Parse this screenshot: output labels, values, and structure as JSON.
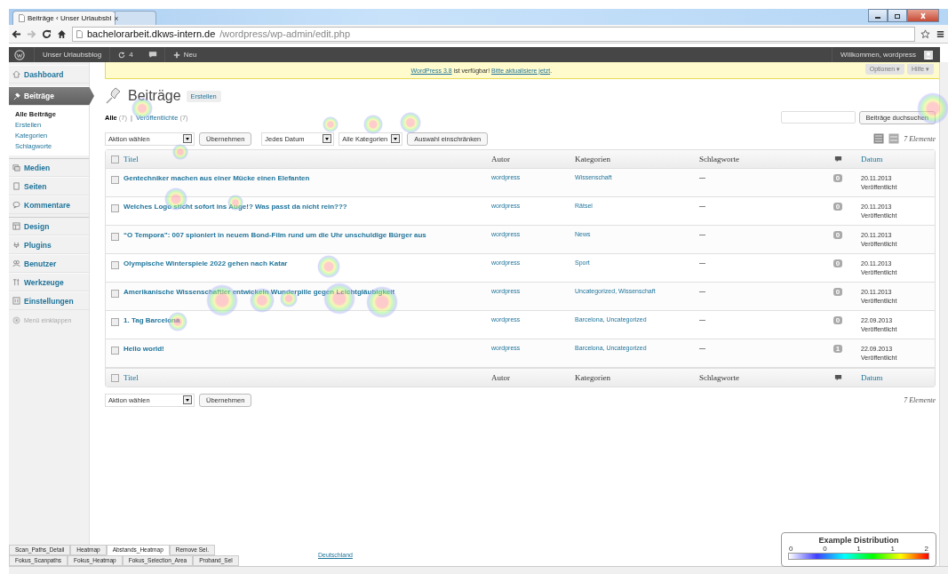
{
  "browser": {
    "tabs": [
      {
        "title": "Beiträge ‹ Unser Urlaubsbl",
        "close": "×",
        "selected": true
      },
      {
        "selected": false
      }
    ],
    "url": {
      "host": "bachelorarbeit.dkws-intern.de",
      "path": "/wordpress/wp-admin/edit.php"
    }
  },
  "admin_bar": {
    "site": "Unser Urlaubsblog",
    "updates": "4",
    "new": "Neu",
    "greeting": "Willkommen, wordpress"
  },
  "sidebar": {
    "items": [
      {
        "label": "Dashboard",
        "selected": false
      },
      {
        "label": "Beiträge",
        "selected": true,
        "children": [
          {
            "label": "Alle Beiträge",
            "selected": true
          },
          {
            "label": "Erstellen",
            "selected": false
          },
          {
            "label": "Kategorien",
            "selected": false
          },
          {
            "label": "Schlagworte",
            "selected": false
          }
        ]
      },
      {
        "label": "Medien",
        "selected": false
      },
      {
        "label": "Seiten",
        "selected": false
      },
      {
        "label": "Kommentare",
        "selected": false
      },
      {
        "label": "Design",
        "selected": false
      },
      {
        "label": "Plugins",
        "selected": false
      },
      {
        "label": "Benutzer",
        "selected": false
      },
      {
        "label": "Werkzeuge",
        "selected": false
      },
      {
        "label": "Einstellungen",
        "selected": false
      }
    ],
    "collapse": "Menü einklappen"
  },
  "notice": {
    "link": "WordPress 3.8",
    "text": " ist verfügbar! ",
    "action": "Bitte aktualisiere jetzt",
    "end": "."
  },
  "screen_buttons": [
    "Optionen ▾",
    "Hilfe ▾"
  ],
  "page": {
    "title": "Beiträge",
    "add_button": "Erstellen"
  },
  "filters": [
    {
      "label": "Alle",
      "count": "(7)",
      "selected": true
    },
    {
      "label": "Veröffentlichte",
      "count": "(7)",
      "selected": false
    }
  ],
  "filter_separator": "|",
  "search": {
    "button": "Beiträge duchsuchen"
  },
  "bulk": {
    "action": "Aktion wählen",
    "apply": "Übernehmen",
    "date": "Jedes Datum",
    "category": "Alle Kategorien",
    "filter": "Auswahl einschränken"
  },
  "count": "7 Elemente",
  "table": {
    "select_all_checked": false,
    "columns": [
      "Titel",
      "Autor",
      "Kategorien",
      "Schlagworte",
      "Datum"
    ],
    "footer_select_all_checked": false,
    "footer_columns": [
      "Titel",
      "Autor",
      "Kategorien",
      "Schlagworte",
      "Datum"
    ],
    "rows": [
      {
        "checked": false,
        "title": "Gentechniker machen aus einer Mücke einen Elefanten",
        "author": "wordpress",
        "categories": "Wissenschaft",
        "tags": "—",
        "comments": "0",
        "date": "20.11.2013",
        "status": "Veröffentlicht"
      },
      {
        "checked": false,
        "title": "Welches Logo sticht sofort ins Auge!? Was passt da nicht rein???",
        "author": "wordpress",
        "categories": "Rätsel",
        "tags": "—",
        "comments": "0",
        "date": "20.11.2013",
        "status": "Veröffentlicht"
      },
      {
        "checked": false,
        "title": "“O Tempora”: 007 spioniert in neuem Bond-Film rund um die Uhr unschuldige Bürger aus",
        "author": "wordpress",
        "categories": "News",
        "tags": "—",
        "comments": "0",
        "date": "20.11.2013",
        "status": "Veröffentlicht"
      },
      {
        "checked": false,
        "title": "Olympische Winterspiele 2022 gehen nach Katar",
        "author": "wordpress",
        "categories": "Sport",
        "tags": "—",
        "comments": "0",
        "date": "20.11.2013",
        "status": "Veröffentlicht"
      },
      {
        "checked": false,
        "title": "Amerikanische Wissenschaftler entwickeln Wunderpille gegen Leichtgläubigkeit",
        "author": "wordpress",
        "categories": "Uncategorized, Wissenschaft",
        "tags": "—",
        "comments": "0",
        "date": "20.11.2013",
        "status": "Veröffentlicht"
      },
      {
        "checked": false,
        "title": "1. Tag Barcelona",
        "author": "wordpress",
        "categories": "Barcelona, Uncategorized",
        "tags": "—",
        "comments": "0",
        "date": "22.09.2013",
        "status": "Veröffentlicht"
      },
      {
        "checked": false,
        "title": "Hello world!",
        "author": "wordpress",
        "categories": "Barcelona, Uncategorized",
        "tags": "—",
        "comments": "1",
        "date": "22.09.2013",
        "status": "Veröffentlicht"
      }
    ]
  },
  "bottom_bulk": {
    "action": "Aktion wählen",
    "apply": "Übernehmen",
    "count": "7 Elemente"
  },
  "footer": {
    "link": "Deutschland"
  },
  "tool_tabs": [
    [
      {
        "label": "Scan_Paths_Detail",
        "selected": false
      },
      {
        "label": "Heatmap",
        "selected": false
      },
      {
        "label": "Abstands_Heatmap",
        "selected": true
      },
      {
        "label": "Remove Sel.",
        "selected": false
      }
    ],
    [
      {
        "label": "Fokus_Scanpaths",
        "selected": false
      },
      {
        "label": "Fokus_Heatmap",
        "selected": false
      },
      {
        "label": "Fokus_Selection_Area",
        "selected": false
      },
      {
        "label": "Proband_Sel",
        "selected": false
      }
    ]
  ],
  "legend": {
    "title": "Example Distribution",
    "ticks": [
      "0",
      "0",
      "1",
      "1",
      "2"
    ]
  }
}
